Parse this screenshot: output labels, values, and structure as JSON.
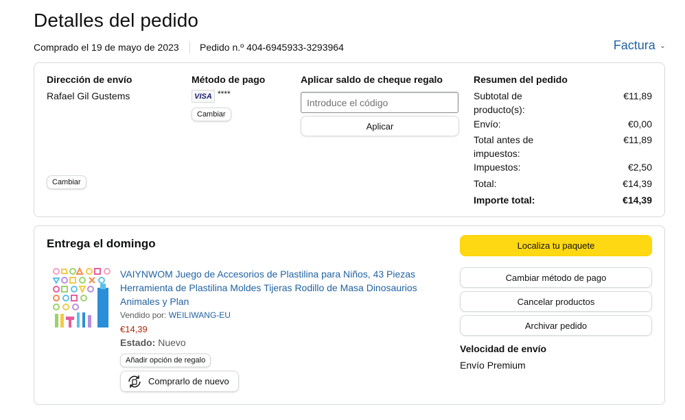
{
  "page": {
    "title": "Detalles del pedido",
    "purchased": "Comprado el 19 de mayo de 2023",
    "order_number": "Pedido n.º 404-6945933-3293964",
    "invoice_label": "Factura"
  },
  "shipping": {
    "heading": "Dirección de envío",
    "name": "Rafael Gil Gustems",
    "change_label": "Cambiar"
  },
  "payment": {
    "heading": "Método de pago",
    "card_brand": "VISA",
    "card_digits": "****",
    "change_label": "Cambiar"
  },
  "gift": {
    "heading": "Aplicar saldo de cheque regalo",
    "placeholder": "Introduce el código",
    "apply_label": "Aplicar"
  },
  "summary": {
    "heading": "Resumen del pedido",
    "rows": [
      {
        "label": "Subtotal de producto(s):",
        "value": "€11,89"
      },
      {
        "label": "Envío:",
        "value": "€0,00"
      },
      {
        "label": "Total antes de impuestos:",
        "value": "€11,89"
      },
      {
        "label": "Impuestos:",
        "value": "€2,50"
      },
      {
        "label": "Total:",
        "value": "€14,39"
      },
      {
        "label": "Importe total:",
        "value": "€14,39"
      }
    ]
  },
  "delivery": {
    "heading": "Entrega el domingo",
    "product_title": "VAIYNWOM Juego de Accesorios de Plastilina para Niños, 43 Piezas Herramienta de Plastilina Moldes Tijeras Rodillo de Masa Dinosaurios Animales y Plan",
    "sold_by_label": "Vendido por:",
    "seller": "WEILIWANG-EU",
    "price": "€14,39",
    "status_label": "Estado:",
    "status_value": "Nuevo",
    "gift_option_label": "Añadir opción de regalo",
    "buy_again_label": "Comprarlo de nuevo"
  },
  "actions": {
    "track": "Localiza tu paquete",
    "change_payment": "Cambiar método de pago",
    "cancel": "Cancelar productos",
    "archive": "Archivar pedido",
    "speed_heading": "Velocidad de envío",
    "speed_value": "Envío Premium"
  },
  "colors": {
    "link": "#2162a1",
    "price": "#b12704",
    "track_button": "#ffd814",
    "border": "#d5d9d9"
  }
}
